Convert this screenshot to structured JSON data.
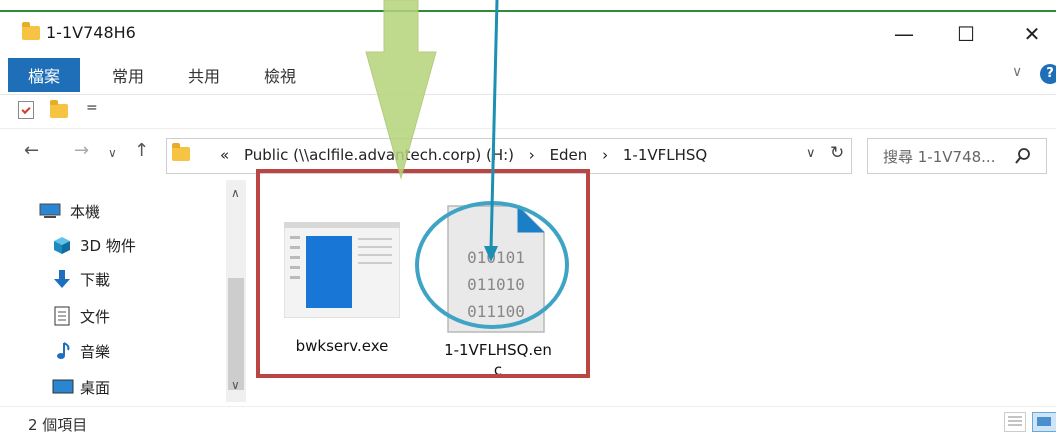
{
  "window": {
    "title": "1-1V748H6",
    "minimize_glyph": "—",
    "maximize_glyph": "☐",
    "close_glyph": "✕"
  },
  "ribbon": {
    "tabs": [
      "檔案",
      "常用",
      "共用",
      "檢視"
    ],
    "active_tab_index": 0,
    "expand_glyph": "∨",
    "help_glyph": "?"
  },
  "qat": {
    "dropdown_glyph": "="
  },
  "navigation": {
    "back_glyph": "←",
    "forward_glyph": "→",
    "recent_glyph": "∨",
    "up_glyph": "↑"
  },
  "address": {
    "overflow_glyph": "«",
    "path": [
      "Public (\\\\aclfile.advantech.corp) (H:)",
      "Eden",
      "1-1VFLHSQ"
    ],
    "separator": "›",
    "dropdown_glyph": "∨",
    "refresh_glyph": "↻"
  },
  "search": {
    "placeholder": "搜尋 1-1V748...",
    "icon": "search-icon"
  },
  "sidebar": {
    "items": [
      {
        "label": "本機",
        "icon": "computer-icon"
      },
      {
        "label": "3D 物件",
        "icon": "cube-icon"
      },
      {
        "label": "下載",
        "icon": "download-arrow-icon"
      },
      {
        "label": "文件",
        "icon": "document-icon"
      },
      {
        "label": "音樂",
        "icon": "music-note-icon"
      },
      {
        "label": "桌面",
        "icon": "desktop-icon"
      }
    ],
    "scroll_up_glyph": "∧",
    "scroll_down_glyph": "∨"
  },
  "files": [
    {
      "name": "bwkserv.exe",
      "icon": "executable-window-icon"
    },
    {
      "name": "1-1VFLHSQ.en\nc",
      "icon": "binary-file-icon",
      "binary_lines": [
        "010101",
        "011010",
        "011100"
      ]
    }
  ],
  "status": {
    "item_count": "2 個項目"
  },
  "colors": {
    "ribbon_active": "#1f6fb8",
    "annotation_box": "#b94642",
    "annotation_circle": "#3fa4c4",
    "annotation_arrow_green": "#b6d47a",
    "annotation_arrow_blue": "#1d8fb2"
  }
}
